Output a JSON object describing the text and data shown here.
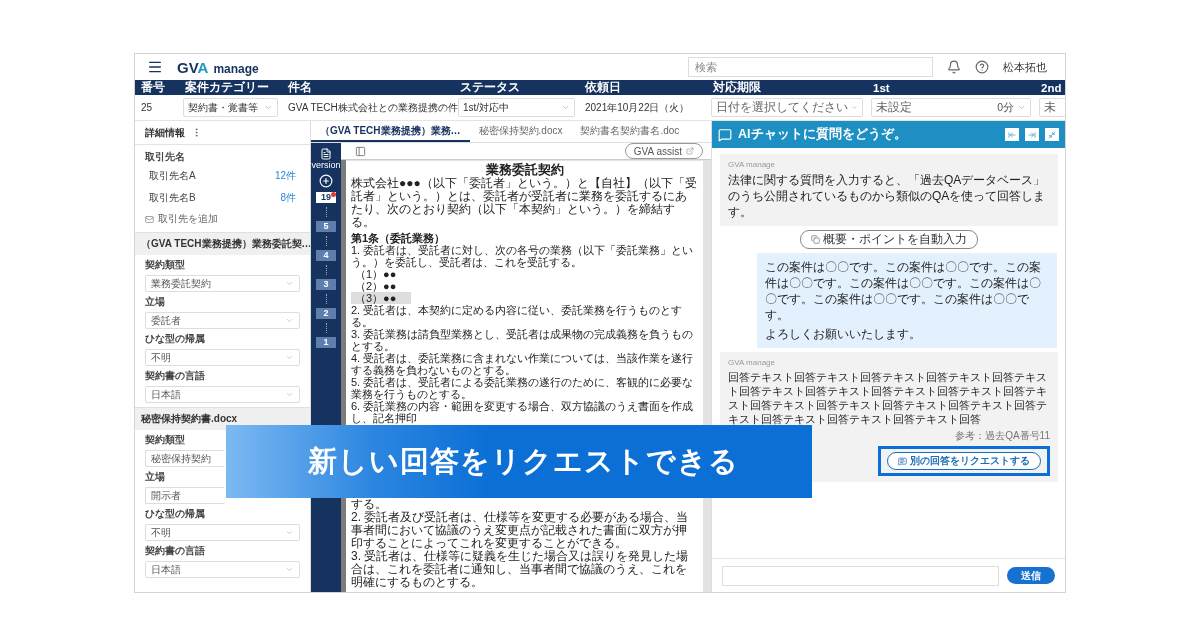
{
  "header": {
    "logo": {
      "letters": "GV",
      "accent": "A",
      "sub": "manage"
    },
    "search": {
      "placeholder": "検索"
    },
    "user": "松本拓也"
  },
  "case_columns": [
    "番号",
    "案件カテゴリー",
    "件名",
    "ステータス",
    "依頼日",
    "対応期限",
    "1st",
    "2nd"
  ],
  "case_row": [
    {
      "kind": "text",
      "value": "25"
    },
    {
      "kind": "select",
      "value": "契約書・覚書等"
    },
    {
      "kind": "text",
      "value": "GVA TECH株式会社との業務提携の件"
    },
    {
      "kind": "select",
      "value": "1st/対応中"
    },
    {
      "kind": "text",
      "value": "2021年10月22日（火）"
    },
    {
      "kind": "select",
      "placeholder": "日付を選択してください"
    },
    {
      "kind": "select",
      "placeholder": "未設定",
      "badge": "0分"
    },
    {
      "kind": "cut",
      "placeholder": "未"
    }
  ],
  "sidebar": {
    "title": "詳細情報",
    "clients_label": "取引先名",
    "clients": [
      {
        "name": "取引先名A",
        "count": "12件"
      },
      {
        "name": "取引先名B",
        "count": "8件"
      }
    ],
    "add_client": "取引先を追加",
    "groups": [
      {
        "title": "（GVA TECH業務提携）業務委託契…",
        "fields": [
          {
            "label": "契約類型",
            "value": "業務委託契約"
          },
          {
            "label": "立場",
            "value": "委託者"
          },
          {
            "label": "ひな型の帰属",
            "value": "不明"
          },
          {
            "label": "契約書の言語",
            "value": "日本語"
          }
        ]
      },
      {
        "title": "秘密保持契約書.docx",
        "fields": [
          {
            "label": "契約類型",
            "value": "秘密保持契約"
          },
          {
            "label": "立場",
            "value": "開示者"
          },
          {
            "label": "ひな型の帰属",
            "value": "不明"
          },
          {
            "label": "契約書の言語",
            "value": "日本語"
          }
        ]
      }
    ]
  },
  "doc_tabs": [
    {
      "label": "（GVA TECH業務提携）業務…",
      "selected": true
    },
    {
      "label": "秘密保持契約.docx",
      "selected": false
    },
    {
      "label": "契約書名契約書名.doc",
      "selected": false
    }
  ],
  "versions": {
    "label": "version",
    "items": [
      {
        "number": "19",
        "selected": true
      },
      {
        "number": "5",
        "selected": false
      },
      {
        "number": "4",
        "selected": false
      },
      {
        "number": "3",
        "selected": false
      },
      {
        "number": "2",
        "selected": false
      },
      {
        "number": "1",
        "selected": false
      }
    ]
  },
  "assist_button": "GVA assist",
  "document": {
    "title": "業務委託契約",
    "upper": [
      {
        "kind": "para",
        "text": "株式会社●●●（以下「委託者」という。）と【自社】（以下「受託者」という。）とは、委託者が受託者に業務を委託するにあたり、次のとおり契約（以下「本契約」という。）を締結する。",
        "highlighted": false
      },
      {
        "kind": "heading",
        "text": "第1条（委託業務）",
        "highlighted": false
      },
      {
        "kind": "para",
        "text": "1. 委託者は、受託者に対し、次の各号の業務（以下「委託業務」という。）を委託し、受託者は、これを受託する。",
        "highlighted": false
      },
      {
        "kind": "item",
        "text": "（1）●●",
        "highlighted": false
      },
      {
        "kind": "item",
        "text": "（2）●●",
        "highlighted": false
      },
      {
        "kind": "item",
        "text": "（3）●●",
        "highlighted": true
      },
      {
        "kind": "para",
        "text": "2. 受託者は、本契約に定める内容に従い、委託業務を行うものとする。",
        "highlighted": false
      },
      {
        "kind": "para",
        "text": "3. 委託業務は請負型業務とし、受託者は成果物の完成義務を負うものとする。",
        "highlighted": false
      },
      {
        "kind": "para",
        "text": "4. 受託者は、委託業務に含まれない作業については、当該作業を遂行する義務を負わないものとする。",
        "highlighted": false
      },
      {
        "kind": "para",
        "text": "5. 委託者は、受託者による委託業務の遂行のために、客観的に必要な業務を行うものとする。",
        "highlighted": false
      },
      {
        "kind": "para",
        "text": "6. 委託業務の内容・範囲を変更する場合、双方協議のうえ書面を作成し、記名押印",
        "highlighted": false
      }
    ],
    "lower": [
      {
        "kind": "para",
        "text": "する。",
        "highlighted": false
      },
      {
        "kind": "para",
        "text": "2. 委託者及び受託者は、仕様等を変更する必要がある場合、当事者間において協議のうえ変更点が記載された書面に双方が押印することによってこれを変更することができる。",
        "highlighted": false
      },
      {
        "kind": "para",
        "text": "3. 受託者は、仕様等に疑義を生じた場合又は誤りを発見した場合は、これを委託者に通知し、当事者間で協議のうえ、これを明確にするものとする。",
        "highlighted": false
      }
    ]
  },
  "chat": {
    "title": "AIチャットに質問をどうぞ。",
    "messages": [
      {
        "kind": "bot",
        "sender": "GVA manage",
        "text": "法律に関する質問を入力すると、「過去QAデータベース」のうち公開されているものから類似のQAを使って回答します。"
      },
      {
        "kind": "action",
        "label": "概要・ポイントを自動入力"
      },
      {
        "kind": "user",
        "text": "この案件は〇〇です。この案件は〇〇です。この案件は〇〇です。この案件は〇〇です。この案件は〇〇です。この案件は〇〇です。この案件は〇〇です。",
        "closing": "よろしくお願いいたします。"
      },
      {
        "kind": "bot",
        "sender": "GVA manage",
        "text": "回答テキスト回答テキスト回答テキスト回答テキスト回答テキスト回答テキスト回答テキスト回答テキスト回答テキスト回答テキスト回答テキスト回答テキスト回答テキスト回答テキスト回答テキスト回答テキスト回答テキスト回答テキスト回答",
        "reference": "参考：過去QA番号11",
        "action": "別の回答をリクエストする"
      }
    ],
    "send": "送信"
  },
  "banner": "新しい回答をリクエストできる"
}
